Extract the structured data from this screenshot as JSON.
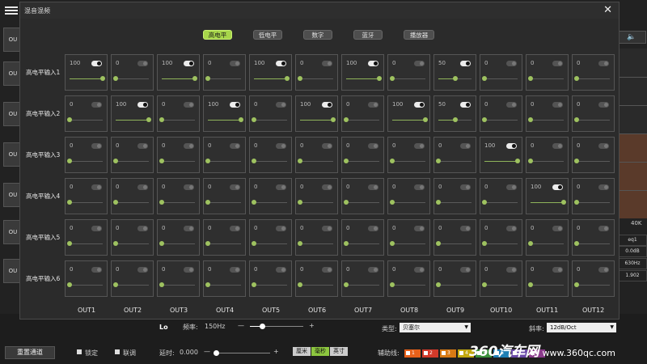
{
  "dialog": {
    "title": "混音混频",
    "close_symbol": "✕"
  },
  "tabs": [
    {
      "label": "高电平",
      "active": true
    },
    {
      "label": "低电平",
      "active": false
    },
    {
      "label": "数字",
      "active": false
    },
    {
      "label": "蓝牙",
      "active": false
    },
    {
      "label": "播放器",
      "active": false
    }
  ],
  "rows": [
    {
      "label": "高电平输入1",
      "cells": [
        {
          "value": "100",
          "on": true
        },
        {
          "value": "0",
          "on": false
        },
        {
          "value": "100",
          "on": true
        },
        {
          "value": "0",
          "on": false
        },
        {
          "value": "100",
          "on": true
        },
        {
          "value": "0",
          "on": false
        },
        {
          "value": "100",
          "on": true
        },
        {
          "value": "0",
          "on": false
        },
        {
          "value": "50",
          "on": true
        },
        {
          "value": "0",
          "on": false
        },
        {
          "value": "0",
          "on": false
        },
        {
          "value": "0",
          "on": false
        }
      ]
    },
    {
      "label": "高电平输入2",
      "cells": [
        {
          "value": "0",
          "on": false
        },
        {
          "value": "100",
          "on": true
        },
        {
          "value": "0",
          "on": false
        },
        {
          "value": "100",
          "on": true
        },
        {
          "value": "0",
          "on": false
        },
        {
          "value": "100",
          "on": true
        },
        {
          "value": "0",
          "on": false
        },
        {
          "value": "100",
          "on": true
        },
        {
          "value": "50",
          "on": true
        },
        {
          "value": "0",
          "on": false
        },
        {
          "value": "0",
          "on": false
        },
        {
          "value": "0",
          "on": false
        }
      ]
    },
    {
      "label": "高电平输入3",
      "cells": [
        {
          "value": "0",
          "on": false
        },
        {
          "value": "0",
          "on": false
        },
        {
          "value": "0",
          "on": false
        },
        {
          "value": "0",
          "on": false
        },
        {
          "value": "0",
          "on": false
        },
        {
          "value": "0",
          "on": false
        },
        {
          "value": "0",
          "on": false
        },
        {
          "value": "0",
          "on": false
        },
        {
          "value": "0",
          "on": false
        },
        {
          "value": "100",
          "on": true
        },
        {
          "value": "0",
          "on": false
        },
        {
          "value": "0",
          "on": false
        }
      ]
    },
    {
      "label": "高电平输入4",
      "cells": [
        {
          "value": "0",
          "on": false
        },
        {
          "value": "0",
          "on": false
        },
        {
          "value": "0",
          "on": false
        },
        {
          "value": "0",
          "on": false
        },
        {
          "value": "0",
          "on": false
        },
        {
          "value": "0",
          "on": false
        },
        {
          "value": "0",
          "on": false
        },
        {
          "value": "0",
          "on": false
        },
        {
          "value": "0",
          "on": false
        },
        {
          "value": "0",
          "on": false
        },
        {
          "value": "100",
          "on": true
        },
        {
          "value": "0",
          "on": false
        }
      ]
    },
    {
      "label": "高电平输入5",
      "cells": [
        {
          "value": "0",
          "on": false
        },
        {
          "value": "0",
          "on": false
        },
        {
          "value": "0",
          "on": false
        },
        {
          "value": "0",
          "on": false
        },
        {
          "value": "0",
          "on": false
        },
        {
          "value": "0",
          "on": false
        },
        {
          "value": "0",
          "on": false
        },
        {
          "value": "0",
          "on": false
        },
        {
          "value": "0",
          "on": false
        },
        {
          "value": "0",
          "on": false
        },
        {
          "value": "0",
          "on": false
        },
        {
          "value": "0",
          "on": false
        }
      ]
    },
    {
      "label": "高电平输入6",
      "cells": [
        {
          "value": "0",
          "on": false
        },
        {
          "value": "0",
          "on": false
        },
        {
          "value": "0",
          "on": false
        },
        {
          "value": "0",
          "on": false
        },
        {
          "value": "0",
          "on": false
        },
        {
          "value": "0",
          "on": false
        },
        {
          "value": "0",
          "on": false
        },
        {
          "value": "0",
          "on": false
        },
        {
          "value": "0",
          "on": false
        },
        {
          "value": "0",
          "on": false
        },
        {
          "value": "0",
          "on": false
        },
        {
          "value": "0",
          "on": false
        }
      ]
    }
  ],
  "columns": [
    "OUT1",
    "OUT2",
    "OUT3",
    "OUT4",
    "OUT5",
    "OUT6",
    "OUT7",
    "OUT8",
    "OUT9",
    "OUT10",
    "OUT11",
    "OUT12"
  ],
  "background": {
    "out_buttons": [
      "OU",
      "OU",
      "OU",
      "OU",
      "OU",
      "OU",
      "OU"
    ],
    "right_panel": {
      "freq_top": "40K",
      "label1": "eq1",
      "gain": "0.0dB",
      "freq": "630Hz",
      "q": "1.902"
    },
    "filter_label": "Lo",
    "freq_label": "频率:",
    "freq_value": "150Hz",
    "freq_minus": "—",
    "freq_plus": "+",
    "type_label": "类型:",
    "type_value": "贝塞尔",
    "slope_label": "斜率:",
    "slope_value": "12dB/Oct",
    "delay_label": "延时:",
    "delay_value": "0.000",
    "delay_minus": "—",
    "delay_plus": "+",
    "units": [
      {
        "label": "厘米",
        "active": false
      },
      {
        "label": "毫秒",
        "active": true
      },
      {
        "label": "英寸",
        "active": false
      }
    ],
    "aux_label": "辅助线:",
    "aux_chips": [
      {
        "label": "1",
        "color": "#e8611a"
      },
      {
        "label": "2",
        "color": "#d23a2a"
      },
      {
        "label": "3",
        "color": "#d87a14"
      },
      {
        "label": "4",
        "color": "#c2a810"
      },
      {
        "label": "5",
        "color": "#3a8f3a"
      },
      {
        "label": "6",
        "color": "#1f7fb5"
      },
      {
        "label": "7",
        "color": "#6a4aa8"
      },
      {
        "label": "8",
        "color": "#8a3a8a"
      }
    ],
    "reset_button": "重置通道",
    "lock_label": "锁定",
    "link_label": "联调",
    "watermark_brand": "360汽车网",
    "watermark_url": "www.360qc.com"
  },
  "colors": {
    "accent": "#a7d64a",
    "slider": "#9ec260"
  }
}
